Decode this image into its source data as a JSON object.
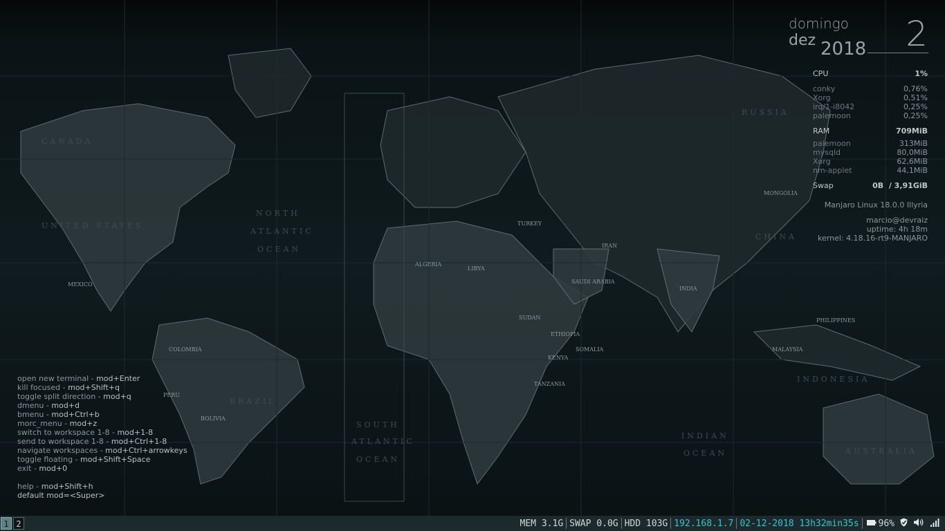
{
  "conky_date": {
    "weekday": "domingo",
    "month": "dez",
    "year": "2018",
    "day": "2"
  },
  "cpu": {
    "label": "CPU",
    "value": "1%",
    "processes": [
      {
        "name": "conky",
        "value": "0,76%"
      },
      {
        "name": "Xorg",
        "value": "0,51%"
      },
      {
        "name": "irq/1-i8042",
        "value": "0,25%"
      },
      {
        "name": "palemoon",
        "value": "0,25%"
      }
    ]
  },
  "ram": {
    "label": "RAM",
    "value": "709MiB",
    "processes": [
      {
        "name": "palemoon",
        "value": "313MiB"
      },
      {
        "name": "mysqld",
        "value": "80,0MiB"
      },
      {
        "name": "Xorg",
        "value": "62,6MiB"
      },
      {
        "name": "nm-applet",
        "value": "44,1MiB"
      }
    ]
  },
  "swap": {
    "label": "Swap",
    "value": "0B  / 3,91GiB"
  },
  "system": {
    "distro": "Manjaro Linux 18.0.0 Illyria",
    "user": "marcio@devraiz",
    "uptime": "uptime: 4h 18m",
    "kernel": "kernel: 4.18.16-rt9-MANJARO"
  },
  "help": {
    "lines": [
      {
        "desc": "open new terminal - ",
        "key": "mod+Enter"
      },
      {
        "desc": "kill focused - ",
        "key": "mod+Shift+q"
      },
      {
        "desc": "toggle split direction - ",
        "key": "mod+q"
      },
      {
        "desc": "dmenu - ",
        "key": "mod+d"
      },
      {
        "desc": "bmenu - ",
        "key": "mod+Ctrl+b"
      },
      {
        "desc": "morc_menu - ",
        "key": "mod+z"
      },
      {
        "desc": "switch to workspace 1-8 - ",
        "key": "mod+1-8"
      },
      {
        "desc": "send to workspace 1-8 - ",
        "key": "mod+Ctrl+1-8"
      },
      {
        "desc": "navigate workspaces - ",
        "key": "mod+Ctrl+arrowkeys"
      },
      {
        "desc": "toggle floating - ",
        "key": "mod+Shift+Space"
      },
      {
        "desc": "exit - ",
        "key": "mod+0"
      }
    ],
    "help_desc": "help - ",
    "help_key": "mod+Shift+h",
    "default_mod": "default mod=<Super>"
  },
  "wallpaper": {
    "ocean_labels": [
      "NORTH",
      "ATLANTIC",
      "OCEAN",
      "SOUTH",
      "ATLANTIC",
      "OCEAN",
      "INDIAN",
      "OCEAN"
    ],
    "region_labels": [
      "CANADA",
      "UNITED STATES",
      "RUSSIA",
      "CHINA",
      "INDIA",
      "BRAZIL",
      "INDONESIA",
      "AUSTRALIA",
      "MEXICO",
      "ALGERIA",
      "LIBYA",
      "SUDAN",
      "SAUDI ARABIA",
      "IRAN",
      "MONGOLIA",
      "PHILIPPINES",
      "ETHIOPIA",
      "COLOMBIA",
      "PERU",
      "BOLIVIA",
      "KENYA",
      "SOMALIA",
      "TANZANIA",
      "MALAYSIA",
      "TURKEY"
    ]
  },
  "bar": {
    "workspaces": [
      "1",
      "2"
    ],
    "active_workspace": "1",
    "mem": "MEM 3.1G",
    "swap": "SWAP 0.0G",
    "hdd": "HDD 103G",
    "ip": "192.168.1.7",
    "datetime": "02-12-2018 13h32min35s",
    "battery": "96%",
    "colors": {
      "accent": "#39c4d0",
      "bar_bg": "#1c2a2d"
    }
  },
  "icons": {
    "battery": "battery-icon",
    "shield": "shield-icon",
    "volume": "volume-icon",
    "network": "wifi-icon"
  }
}
